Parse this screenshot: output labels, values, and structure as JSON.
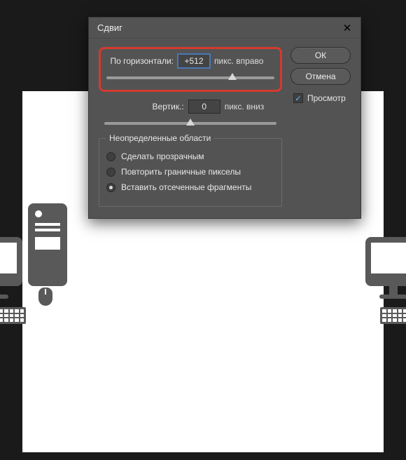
{
  "dialog": {
    "title": "Сдвиг",
    "horizontal": {
      "label": "По горизонтали:",
      "value": "+512",
      "unit": "пикс. вправо",
      "slider_pos_percent": 75
    },
    "vertical": {
      "label": "Вертик.:",
      "value": "0",
      "unit": "пикс. вниз",
      "slider_pos_percent": 50
    },
    "undefined_areas": {
      "legend": "Неопределенные области",
      "options": [
        "Сделать прозрачным",
        "Повторить граничные пикселы",
        "Вставить отсеченные фрагменты"
      ],
      "selected_index": 2
    },
    "buttons": {
      "ok": "ОК",
      "cancel": "Отмена"
    },
    "preview": {
      "label": "Просмотр",
      "checked": true
    }
  }
}
